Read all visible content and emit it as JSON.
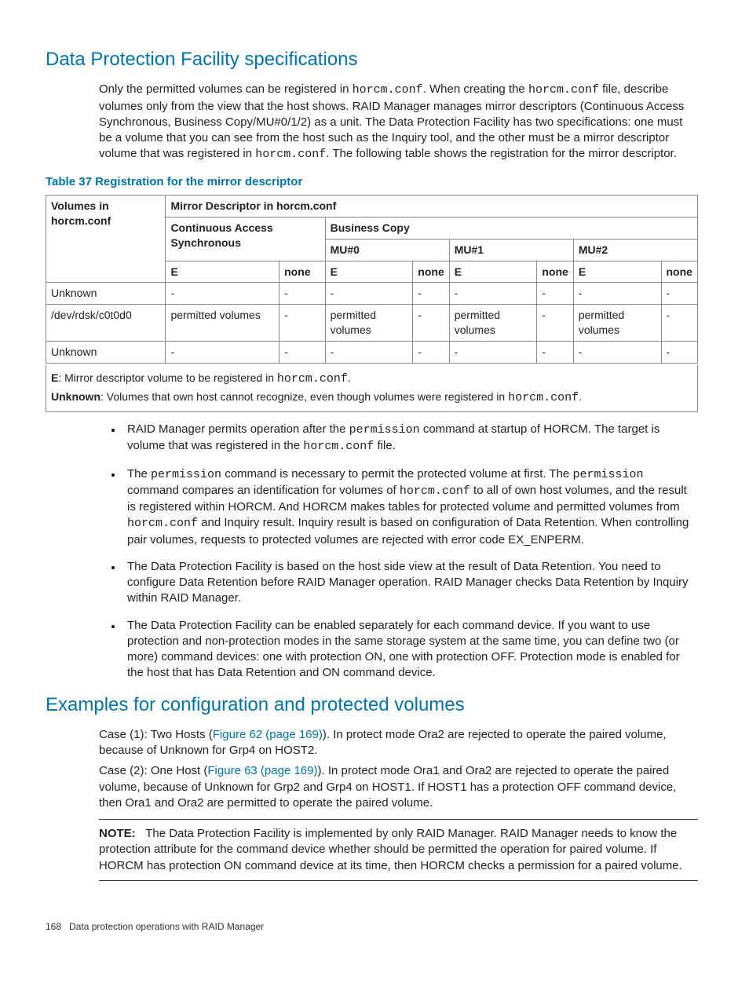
{
  "h1": "Data Protection Facility specifications",
  "para1_a": "Only the permitted volumes can be registered in ",
  "para1_code1": "horcm.conf",
  "para1_b": ". When creating the ",
  "para1_code2": "horcm.conf",
  "para1_c": " file, describe volumes only from the view that the host shows. RAID Manager manages mirror descriptors (Continuous Access Synchronous, Business Copy/MU#0/1/2) as a unit. The Data Protection Facility has two specifications: one must be a volume that you can see from the host such as the Inquiry tool, and the other must be a mirror descriptor volume that was registered in ",
  "para1_code3": "horcm.conf",
  "para1_d": ". The following table shows the registration for the mirror descriptor.",
  "table_caption": "Table 37 Registration for the mirror descriptor",
  "table": {
    "header": {
      "col_volumes": "Volumes in horcm.conf",
      "col_mirror": "Mirror Descriptor in horcm.conf",
      "col_cas": "Continuous Access Synchronous",
      "col_bc": "Business Copy",
      "col_mu0": "MU#0",
      "col_mu1": "MU#1",
      "col_mu2": "MU#2",
      "e": "E",
      "none": "none"
    },
    "rows": [
      {
        "vol": "Unknown",
        "c": [
          "-",
          "-",
          "-",
          "-",
          "-",
          "-",
          "-",
          "-"
        ]
      },
      {
        "vol": "/dev/rdsk/c0t0d0",
        "c": [
          "permitted volumes",
          "-",
          "permitted volumes",
          "-",
          "permitted volumes",
          "-",
          "permitted volumes",
          "-"
        ]
      },
      {
        "vol": "Unknown",
        "c": [
          "-",
          "-",
          "-",
          "-",
          "-",
          "-",
          "-",
          "-"
        ]
      }
    ],
    "notes": {
      "e_label": "E",
      "e_text": ": Mirror descriptor volume to be registered in ",
      "e_code": "horcm.conf",
      "e_end": ".",
      "u_label": "Unknown",
      "u_text": ": Volumes that own host cannot recognize, even though volumes were registered in ",
      "u_code": "horcm.conf",
      "u_end": "."
    }
  },
  "bullets": {
    "b1_a": "RAID Manager permits operation after the ",
    "b1_code1": "permission",
    "b1_b": " command at startup of HORCM. The target is volume that was registered in the ",
    "b1_code2": "horcm.conf",
    "b1_c": " file.",
    "b2_a": "The ",
    "b2_code1": "permission",
    "b2_b": " command is necessary to permit the protected volume at first. The ",
    "b2_code2": "permission",
    "b2_c": " command compares an identification for volumes of ",
    "b2_code3": "horcm.conf",
    "b2_d": " to all of own host volumes, and the result is registered within HORCM. And HORCM makes tables for protected volume and permitted volumes from ",
    "b2_code4": "horcm.conf",
    "b2_e": " and Inquiry result. Inquiry result is based on configuration of Data Retention. When controlling pair volumes, requests to protected volumes are rejected with error code EX_ENPERM.",
    "b3": "The Data Protection Facility is based on the host side view at the result of Data Retention. You need to configure Data Retention before RAID Manager operation. RAID Manager checks Data Retention by Inquiry within RAID Manager.",
    "b4": "The Data Protection Facility can be enabled separately for each command device. If you want to use protection and non-protection modes in the same storage system at the same time, you can define two (or more) command devices: one with protection ON, one with protection OFF. Protection mode is enabled for the host that has Data Retention and ON command device."
  },
  "h2": "Examples for configuration and protected volumes",
  "case1_a": "Case (1): Two Hosts (",
  "case1_link": "Figure 62 (page 169)",
  "case1_b": "). In protect mode Ora2 are rejected to operate the paired volume, because of Unknown for Grp4 on HOST2.",
  "case2_a": "Case (2): One Host (",
  "case2_link": "Figure 63 (page 169)",
  "case2_b": "). In protect mode Ora1 and Ora2 are rejected to operate the paired volume, because of Unknown for Grp2 and Grp4 on HOST1. If HOST1 has a protection OFF command device, then Ora1 and Ora2 are permitted to operate the paired volume.",
  "note_label": "NOTE:",
  "note_text": "The Data Protection Facility is implemented by only RAID Manager. RAID Manager needs to know the protection attribute for the command device whether should be permitted the operation for paired volume. If HORCM has protection ON command device at its time, then HORCM checks a permission for a paired volume.",
  "footer_page": "168",
  "footer_text": "Data protection operations with RAID Manager"
}
